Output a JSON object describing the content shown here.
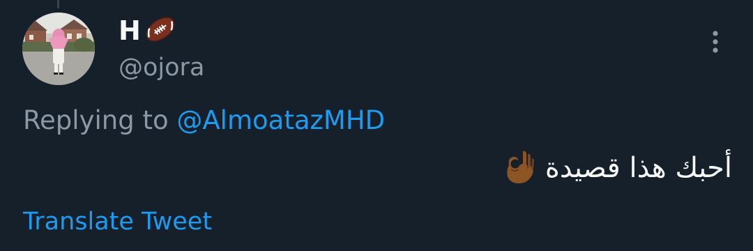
{
  "tweet": {
    "display_name": "H",
    "display_name_emoji": "american-football-icon",
    "handle": "@ojora",
    "replying_prefix": "Replying to",
    "replying_to": "@AlmoatazMHD",
    "text": "أحبك هذا قصيدة",
    "text_emoji": "ok-hand-icon",
    "translate_label": "Translate Tweet"
  },
  "colors": {
    "background": "#15202b",
    "primary_text": "#f7f9f9",
    "secondary_text": "#8b98a5",
    "accent": "#1d9bf0",
    "thread_line": "#38444d"
  },
  "icons": {
    "more": "more-vertical-icon",
    "avatar": "avatar"
  }
}
